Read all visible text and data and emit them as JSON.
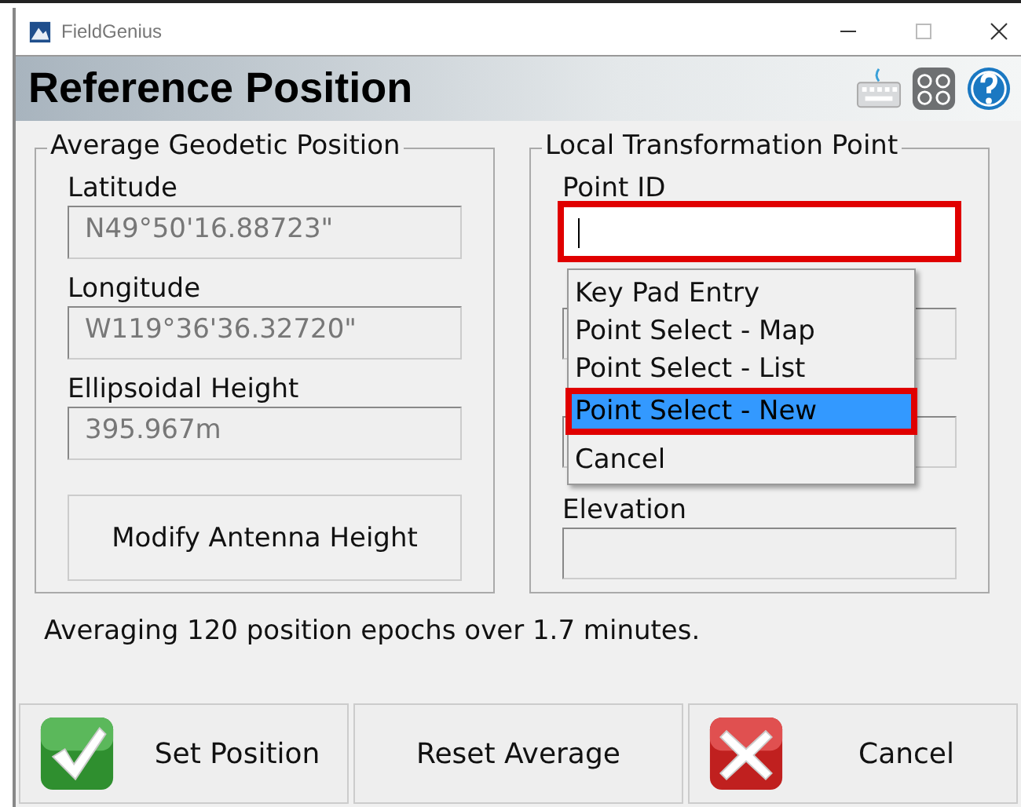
{
  "window": {
    "title": "FieldGenius"
  },
  "header": {
    "title": "Reference Position"
  },
  "left_group": {
    "title": "Average Geodetic Position",
    "fields": [
      {
        "label": "Latitude",
        "value": "N49°50'16.88723\""
      },
      {
        "label": "Longitude",
        "value": "W119°36'36.32720\""
      },
      {
        "label": "Ellipsoidal Height",
        "value": "395.967m"
      }
    ],
    "button": "Modify Antenna Height"
  },
  "right_group": {
    "title": "Local Transformation Point",
    "point_id": {
      "label": "Point ID",
      "focused": true,
      "annotated": true
    },
    "fields": [
      {
        "kind": "covered"
      },
      {
        "kind": "covered"
      },
      {
        "kind": "labeled",
        "label": "Elevation"
      }
    ],
    "menu": [
      {
        "label": "Key Pad Entry",
        "selected": false,
        "annotated": false
      },
      {
        "label": "Point Select - Map",
        "selected": false,
        "annotated": false
      },
      {
        "label": "Point Select - List",
        "selected": false,
        "annotated": false
      },
      {
        "label": "Point Select - New",
        "selected": true,
        "annotated": true
      },
      {
        "label": "Cancel",
        "selected": false,
        "annotated": false
      }
    ]
  },
  "status": "Averaging 120 position epochs over 1.7 minutes.",
  "buttons": [
    {
      "kind": "ok",
      "label": "Set Position"
    },
    {
      "kind": "plain",
      "label": "Reset Average"
    },
    {
      "kind": "cancel",
      "label": "Cancel"
    }
  ]
}
